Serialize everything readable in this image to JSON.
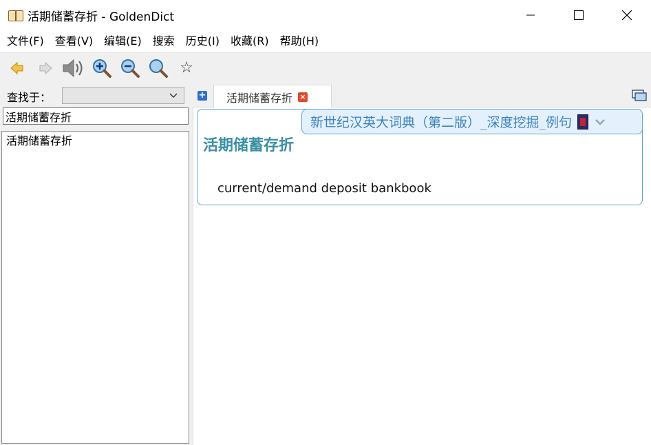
{
  "window": {
    "title": "活期储蓄存折 - GoldenDict",
    "app_icon": "open-book-icon",
    "controls": [
      "minimize-icon",
      "maximize-icon",
      "close-icon"
    ]
  },
  "menu": {
    "items": [
      "文件(F)",
      "查看(V)",
      "编辑(E)",
      "搜索",
      "历史(I)",
      "收藏(R)",
      "帮助(H)"
    ]
  },
  "toolbar": {
    "buttons": [
      {
        "icon": "back-arrow-icon",
        "enabled": true
      },
      {
        "icon": "forward-arrow-icon",
        "enabled": false
      },
      {
        "icon": "speaker-icon",
        "enabled": true
      },
      {
        "icon": "zoom-in-icon",
        "enabled": true
      },
      {
        "icon": "zoom-out-icon",
        "enabled": true
      },
      {
        "icon": "zoom-normal-icon",
        "enabled": true
      },
      {
        "icon": "star-icon",
        "enabled": true
      }
    ],
    "star_glyph": "☆"
  },
  "left": {
    "lookin_label": "查找于：",
    "lookin_value": "",
    "search_value": "活期储蓄存折",
    "word_list": [
      "活期储蓄存折"
    ]
  },
  "tabs": {
    "new_tab_glyph": "+",
    "active": {
      "label": "活期储蓄存折",
      "close_glyph": "×"
    }
  },
  "article": {
    "dictionary_name": "新世纪汉英大词典（第二版）_深度挖掘_例句",
    "headword": "活期储蓄存折",
    "definition": "current/demand deposit bankbook"
  },
  "colors": {
    "accent_border": "#5da6d6",
    "dict_header_bg": "#e4f0fb",
    "dict_name": "#3b83c0",
    "headword": "#3a8fa3"
  }
}
